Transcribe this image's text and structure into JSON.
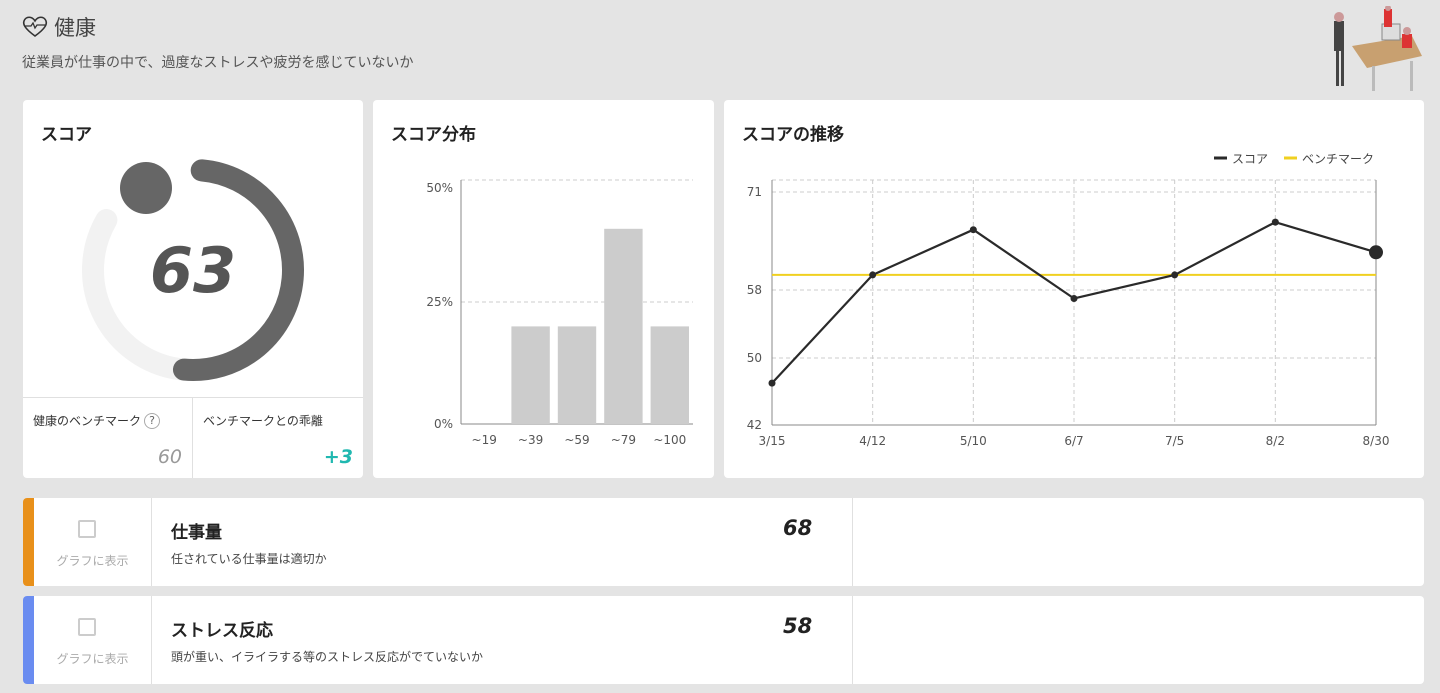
{
  "header": {
    "title": "健康",
    "subtitle": "従業員が仕事の中で、過度なストレスや疲労を感じていないか",
    "icon": "heart-pulse-icon"
  },
  "score_card": {
    "title": "スコア",
    "score": "63",
    "score_value": 63,
    "benchmark_label": "健康のベンチマーク",
    "help": "?",
    "benchmark_value": "60",
    "diff_label": "ベンチマークとの乖離",
    "diff_value": "+3",
    "diff_color": "#20b8b0",
    "gauge_color": "#666666"
  },
  "chart_data": [
    {
      "type": "bar",
      "title": "スコア分布",
      "categories": [
        "~19",
        "~39",
        "~59",
        "~79",
        "~100"
      ],
      "values": [
        0,
        20,
        20,
        40,
        20
      ],
      "unit": "%",
      "ylim": [
        0,
        50
      ],
      "yticks": [
        "0%",
        "25%",
        "50%"
      ],
      "ytick_values": [
        0,
        25,
        50
      ],
      "grid": true
    },
    {
      "type": "line",
      "title": "スコアの推移",
      "x": [
        "3/15",
        "4/12",
        "5/10",
        "6/7",
        "7/5",
        "8/2",
        "8/30"
      ],
      "series": [
        {
          "name": "スコア",
          "values": [
            47,
            60,
            66,
            57,
            60,
            67,
            63
          ],
          "color": "#2a2a2a"
        },
        {
          "name": "ベンチマーク",
          "values": [
            60,
            60,
            60,
            60,
            60,
            60,
            60
          ],
          "color": "#f0d020"
        }
      ],
      "yticks": [
        "42",
        "50",
        "58",
        "71"
      ],
      "ytick_values": [
        42,
        50,
        58,
        71
      ],
      "ylim": [
        42,
        71
      ],
      "legend": "top-right",
      "grid": true
    }
  ],
  "rows": [
    {
      "name": "仕事量",
      "desc": "任されている仕事量は適切か",
      "score": "68",
      "color": "#e8901a",
      "show_label": "グラフに表示"
    },
    {
      "name": "ストレス反応",
      "desc": "頭が重い、イライラする等のストレス反応がでていないか",
      "score": "58",
      "color": "#6a8cf0",
      "show_label": "グラフに表示"
    }
  ]
}
